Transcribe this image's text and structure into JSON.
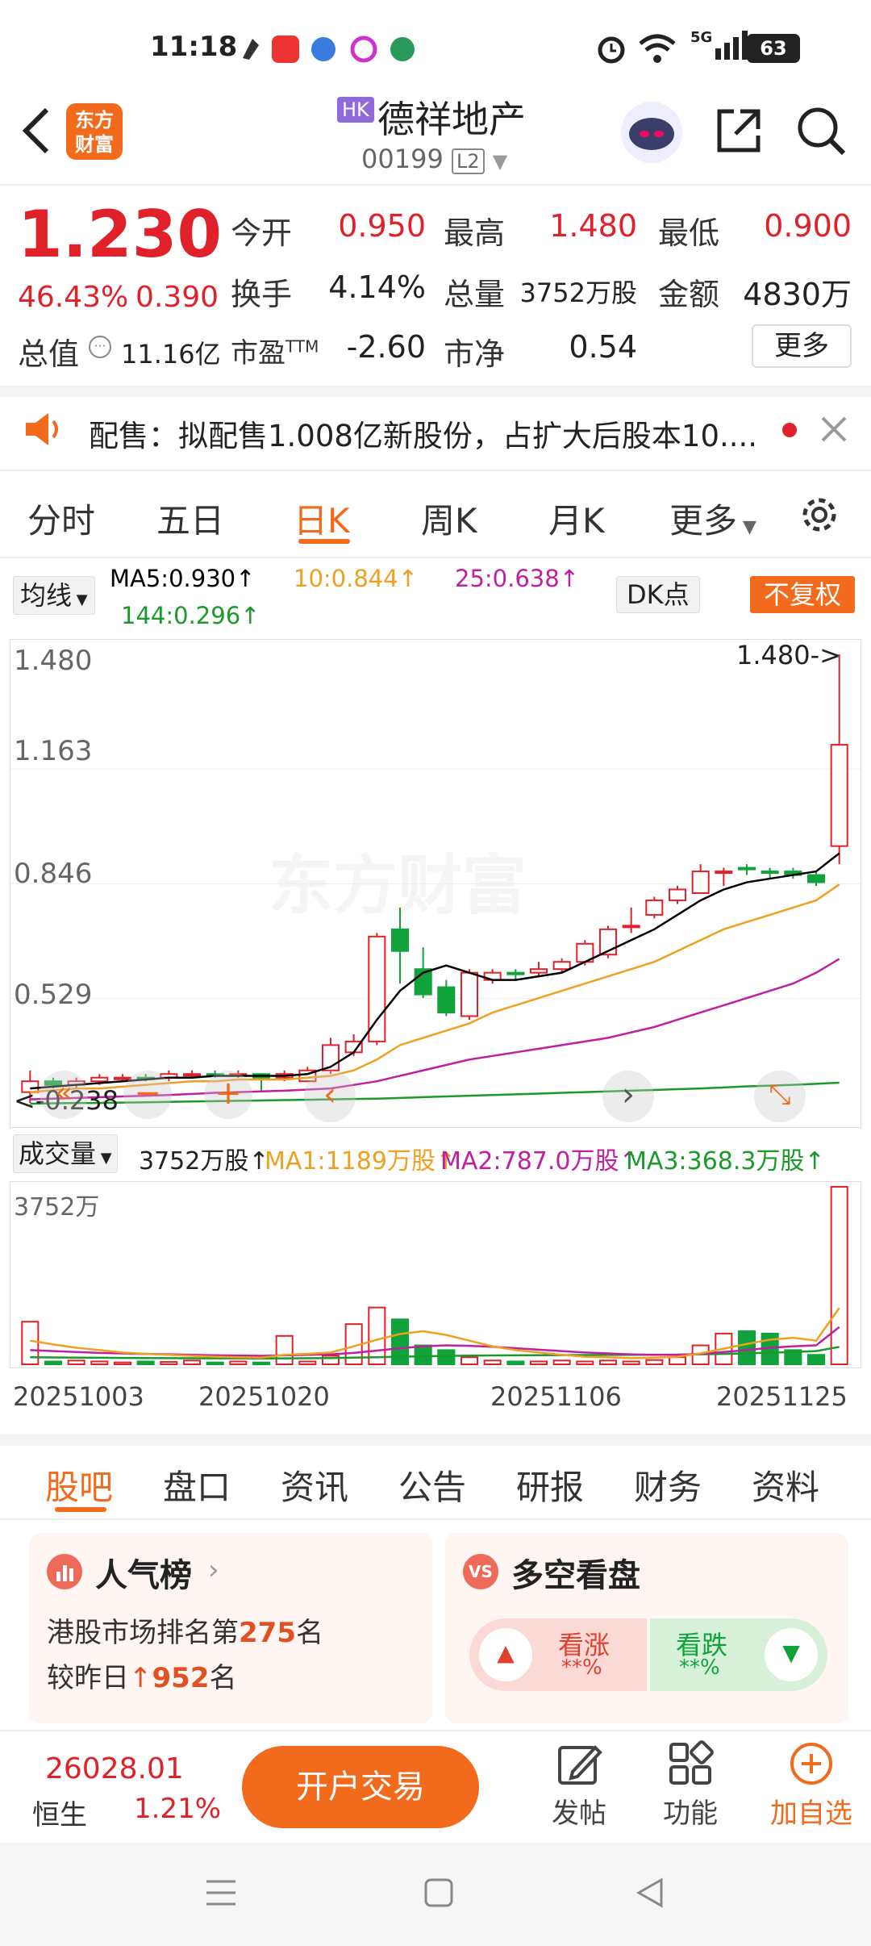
{
  "status": {
    "time": "11:18",
    "battery": "63",
    "signal": "5G"
  },
  "header": {
    "logo_line1": "东方",
    "logo_line2": "财富",
    "market_badge": "HK",
    "stock_name": "德祥地产",
    "stock_code": "00199",
    "level_badge": "L2"
  },
  "quote": {
    "price": "1.230",
    "change_pct": "46.43%",
    "change_amt": "0.390",
    "open_label": "今开",
    "open": "0.950",
    "high_label": "最高",
    "high": "1.480",
    "low_label": "最低",
    "low": "0.900",
    "turnover_label": "换手",
    "turnover": "4.14%",
    "volume_label": "总量",
    "volume": "3752万股",
    "amount_label": "金额",
    "amount": "4830万",
    "mktcap_label": "总值",
    "mktcap": "11.16亿",
    "pe_label": "市盈",
    "pe_sup": "TTM",
    "pe": "-2.60",
    "pb_label": "市净",
    "pb": "0.54",
    "more": "更多"
  },
  "notice": {
    "text": "配售：拟配售1.008亿新股份，占扩大后股本10...."
  },
  "chart_tabs": [
    "分时",
    "五日",
    "日K",
    "周K",
    "月K",
    "更多"
  ],
  "active_chart_tab": "日K",
  "ma_bar": {
    "selector": "均线",
    "ma5": "MA5:0.930↑",
    "ma10": "10:0.844↑",
    "ma25": "25:0.638↑",
    "ma144": "144:0.296↑",
    "dk": "DK点",
    "fq": "不复权"
  },
  "price_axis": {
    "labels": [
      "1.480",
      "1.163",
      "0.846",
      "0.529"
    ],
    "max_marker": "1.480->",
    "min_marker": "0.238"
  },
  "vol_bar": {
    "selector": "成交量",
    "vol": "3752万股↑",
    "ma1": "MA1:1189万股↑",
    "ma2": "MA2:787.0万股↑",
    "ma3": "MA3:368.3万股↑",
    "axis_top": "3752万"
  },
  "dates": [
    "20251003",
    "20251020",
    "20251106",
    "20251125"
  ],
  "chart_data": {
    "type": "candlestick",
    "ylim": [
      0.238,
      1.48
    ],
    "candles": [
      {
        "o": 0.27,
        "c": 0.3,
        "h": 0.33,
        "l": 0.24,
        "up": true
      },
      {
        "o": 0.3,
        "c": 0.29,
        "h": 0.31,
        "l": 0.28,
        "up": false
      },
      {
        "o": 0.29,
        "c": 0.3,
        "h": 0.31,
        "l": 0.28,
        "up": true
      },
      {
        "o": 0.3,
        "c": 0.31,
        "h": 0.32,
        "l": 0.29,
        "up": true
      },
      {
        "o": 0.31,
        "c": 0.31,
        "h": 0.32,
        "l": 0.3,
        "up": true
      },
      {
        "o": 0.31,
        "c": 0.31,
        "h": 0.32,
        "l": 0.3,
        "up": false
      },
      {
        "o": 0.31,
        "c": 0.32,
        "h": 0.33,
        "l": 0.3,
        "up": true
      },
      {
        "o": 0.32,
        "c": 0.32,
        "h": 0.33,
        "l": 0.31,
        "up": true
      },
      {
        "o": 0.32,
        "c": 0.32,
        "h": 0.33,
        "l": 0.31,
        "up": false
      },
      {
        "o": 0.32,
        "c": 0.32,
        "h": 0.33,
        "l": 0.31,
        "up": true
      },
      {
        "o": 0.32,
        "c": 0.31,
        "h": 0.32,
        "l": 0.27,
        "up": false
      },
      {
        "o": 0.31,
        "c": 0.32,
        "h": 0.33,
        "l": 0.3,
        "up": true
      },
      {
        "o": 0.3,
        "c": 0.33,
        "h": 0.34,
        "l": 0.3,
        "up": true
      },
      {
        "o": 0.33,
        "c": 0.4,
        "h": 0.42,
        "l": 0.32,
        "up": true
      },
      {
        "o": 0.38,
        "c": 0.41,
        "h": 0.43,
        "l": 0.37,
        "up": true
      },
      {
        "o": 0.41,
        "c": 0.7,
        "h": 0.71,
        "l": 0.4,
        "up": true
      },
      {
        "o": 0.72,
        "c": 0.66,
        "h": 0.78,
        "l": 0.57,
        "up": false
      },
      {
        "o": 0.61,
        "c": 0.54,
        "h": 0.67,
        "l": 0.53,
        "up": false
      },
      {
        "o": 0.56,
        "c": 0.49,
        "h": 0.58,
        "l": 0.48,
        "up": false
      },
      {
        "o": 0.48,
        "c": 0.6,
        "h": 0.61,
        "l": 0.47,
        "up": true
      },
      {
        "o": 0.58,
        "c": 0.6,
        "h": 0.61,
        "l": 0.57,
        "up": true
      },
      {
        "o": 0.6,
        "c": 0.6,
        "h": 0.61,
        "l": 0.58,
        "up": false
      },
      {
        "o": 0.6,
        "c": 0.61,
        "h": 0.63,
        "l": 0.59,
        "up": true
      },
      {
        "o": 0.61,
        "c": 0.63,
        "h": 0.64,
        "l": 0.6,
        "up": true
      },
      {
        "o": 0.63,
        "c": 0.68,
        "h": 0.69,
        "l": 0.62,
        "up": true
      },
      {
        "o": 0.65,
        "c": 0.72,
        "h": 0.73,
        "l": 0.64,
        "up": true
      },
      {
        "o": 0.73,
        "c": 0.73,
        "h": 0.78,
        "l": 0.71,
        "up": true
      },
      {
        "o": 0.76,
        "c": 0.8,
        "h": 0.81,
        "l": 0.75,
        "up": true
      },
      {
        "o": 0.8,
        "c": 0.83,
        "h": 0.84,
        "l": 0.79,
        "up": true
      },
      {
        "o": 0.82,
        "c": 0.88,
        "h": 0.9,
        "l": 0.82,
        "up": true
      },
      {
        "o": 0.88,
        "c": 0.88,
        "h": 0.89,
        "l": 0.84,
        "up": true
      },
      {
        "o": 0.89,
        "c": 0.89,
        "h": 0.9,
        "l": 0.87,
        "up": false
      },
      {
        "o": 0.88,
        "c": 0.88,
        "h": 0.89,
        "l": 0.86,
        "up": false
      },
      {
        "o": 0.88,
        "c": 0.87,
        "h": 0.89,
        "l": 0.86,
        "up": false
      },
      {
        "o": 0.87,
        "c": 0.85,
        "h": 0.88,
        "l": 0.84,
        "up": false
      },
      {
        "o": 0.95,
        "c": 1.23,
        "h": 1.48,
        "l": 0.9,
        "up": true
      }
    ],
    "ma5": [
      0.28,
      0.285,
      0.29,
      0.295,
      0.3,
      0.305,
      0.31,
      0.31,
      0.315,
      0.315,
      0.315,
      0.315,
      0.32,
      0.34,
      0.38,
      0.47,
      0.55,
      0.6,
      0.62,
      0.6,
      0.58,
      0.58,
      0.59,
      0.6,
      0.63,
      0.66,
      0.69,
      0.72,
      0.76,
      0.8,
      0.83,
      0.85,
      0.86,
      0.87,
      0.88,
      0.93
    ],
    "ma10": [
      0.27,
      0.275,
      0.28,
      0.28,
      0.285,
      0.29,
      0.295,
      0.3,
      0.3,
      0.305,
      0.305,
      0.305,
      0.31,
      0.315,
      0.33,
      0.36,
      0.4,
      0.42,
      0.44,
      0.46,
      0.49,
      0.51,
      0.53,
      0.55,
      0.57,
      0.59,
      0.61,
      0.63,
      0.66,
      0.69,
      0.72,
      0.74,
      0.76,
      0.78,
      0.8,
      0.844
    ],
    "ma25": [
      0.25,
      0.252,
      0.254,
      0.256,
      0.258,
      0.26,
      0.262,
      0.265,
      0.268,
      0.27,
      0.272,
      0.274,
      0.277,
      0.28,
      0.29,
      0.3,
      0.315,
      0.33,
      0.345,
      0.36,
      0.37,
      0.38,
      0.39,
      0.4,
      0.41,
      0.42,
      0.435,
      0.45,
      0.47,
      0.49,
      0.51,
      0.53,
      0.55,
      0.57,
      0.6,
      0.638
    ],
    "ma144": [
      0.238,
      0.239,
      0.24,
      0.24,
      0.241,
      0.242,
      0.243,
      0.244,
      0.245,
      0.246,
      0.247,
      0.248,
      0.249,
      0.25,
      0.251,
      0.252,
      0.254,
      0.256,
      0.258,
      0.26,
      0.262,
      0.264,
      0.266,
      0.268,
      0.27,
      0.272,
      0.274,
      0.276,
      0.278,
      0.28,
      0.283,
      0.286,
      0.288,
      0.29,
      0.293,
      0.296
    ],
    "volume_max": 3752,
    "volumes": [
      900,
      60,
      80,
      60,
      40,
      60,
      50,
      80,
      40,
      60,
      40,
      600,
      60,
      180,
      850,
      1200,
      950,
      400,
      300,
      150,
      80,
      60,
      60,
      80,
      60,
      80,
      60,
      90,
      150,
      400,
      650,
      700,
      650,
      300,
      200,
      3752
    ],
    "vol_ma1": [
      500,
      420,
      350,
      300,
      250,
      220,
      200,
      180,
      160,
      150,
      140,
      200,
      220,
      250,
      380,
      520,
      640,
      700,
      620,
      500,
      380,
      300,
      250,
      200,
      160,
      150,
      130,
      140,
      160,
      230,
      330,
      430,
      520,
      560,
      500,
      1189
    ],
    "vol_ma2": [
      300,
      280,
      260,
      240,
      230,
      220,
      210,
      200,
      190,
      185,
      180,
      190,
      200,
      210,
      240,
      290,
      340,
      380,
      400,
      390,
      370,
      340,
      310,
      280,
      250,
      230,
      210,
      200,
      200,
      220,
      260,
      300,
      350,
      380,
      400,
      787
    ],
    "vol_ma3": [
      150,
      145,
      140,
      138,
      135,
      132,
      130,
      128,
      126,
      125,
      124,
      126,
      128,
      132,
      140,
      150,
      160,
      170,
      178,
      184,
      188,
      190,
      192,
      194,
      196,
      198,
      200,
      202,
      205,
      210,
      220,
      232,
      245,
      260,
      280,
      368
    ]
  },
  "bottom_tabs": [
    "股吧",
    "盘口",
    "资讯",
    "公告",
    "研报",
    "财务",
    "资料"
  ],
  "cards": {
    "popularity_title": "人气榜",
    "popularity_line1_a": "港股市场排名第",
    "popularity_rank": "275",
    "popularity_line1_b": "名",
    "popularity_line2_a": "较昨日",
    "popularity_change": "952",
    "popularity_line2_b": "名",
    "duokong_title": "多空看盘",
    "bull_label": "看涨",
    "bull_pct": "**%",
    "bear_label": "看跌",
    "bear_pct": "**%"
  },
  "footer": {
    "index_value": "26028.01",
    "index_name": "恒生",
    "index_change": "1.21%",
    "trade_button": "开户交易",
    "post": "发帖",
    "func": "功能",
    "add": "加自选"
  },
  "colors": {
    "brand": "#f26a1b",
    "up": "#e0212a",
    "down": "#11a33b",
    "ma5": "#000000",
    "ma10": "#f0a020",
    "ma25": "#c020a0",
    "ma144": "#1a9a2a"
  }
}
